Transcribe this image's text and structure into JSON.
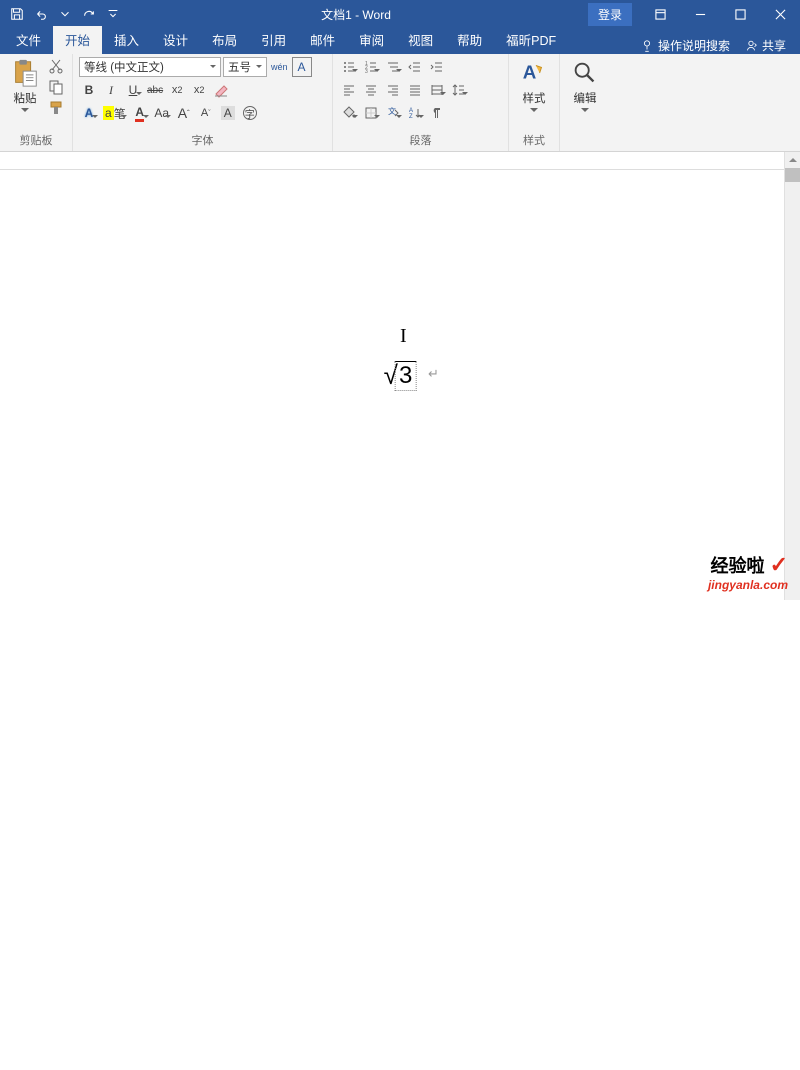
{
  "titlebar": {
    "title": "文档1 - Word",
    "login": "登录"
  },
  "tabs": {
    "file": "文件",
    "home": "开始",
    "insert": "插入",
    "design": "设计",
    "layout": "布局",
    "references": "引用",
    "mailings": "邮件",
    "review": "审阅",
    "view": "视图",
    "help": "帮助",
    "foxit": "福昕PDF",
    "tell_me": "操作说明搜索",
    "share": "共享"
  },
  "ribbon": {
    "clipboard": {
      "label": "剪贴板",
      "paste": "粘贴"
    },
    "font": {
      "label": "字体",
      "name": "等线 (中文正文)",
      "size": "五号",
      "wen": "wén",
      "bold": "B",
      "italic": "I",
      "underline": "U",
      "strike": "abc",
      "sub": "x₂",
      "sup": "x²",
      "A_circle": "A",
      "aY": "a笔",
      "AColor": "A",
      "Aa": "Aa",
      "Agrow": "A",
      "Ashrink": "A",
      "Aclear": "A",
      "Astyle": "A"
    },
    "paragraph": {
      "label": "段落"
    },
    "styles": {
      "label": "样式",
      "btn": "样式"
    },
    "editing": {
      "label": "编辑",
      "btn": "编辑"
    }
  },
  "doc": {
    "radical": "√",
    "radicand": "3"
  },
  "watermark": {
    "line1": "经验啦",
    "check": "✓",
    "line2": "jingyanla.com"
  }
}
